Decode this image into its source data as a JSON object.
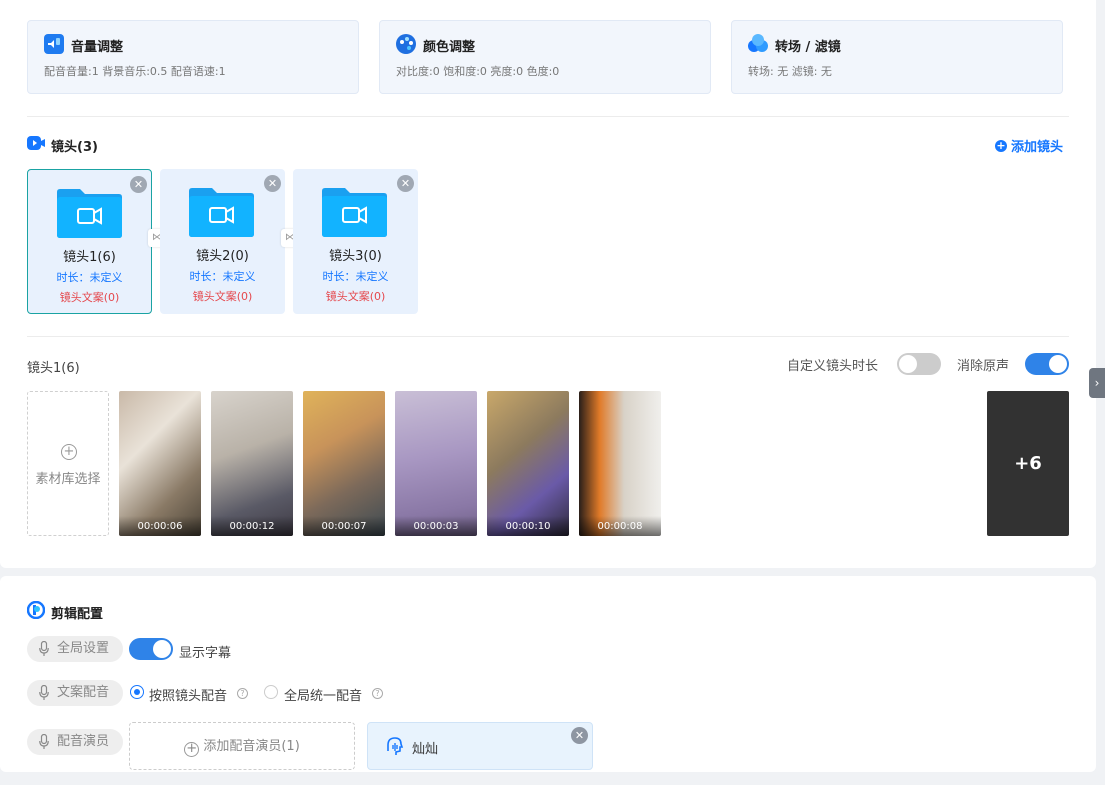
{
  "adjust_cards": [
    {
      "title": "音量调整",
      "sub": "配音音量:1 背景音乐:0.5 配音语速:1"
    },
    {
      "title": "颜色调整",
      "sub": "对比度:0 饱和度:0 亮度:0 色度:0"
    },
    {
      "title": "转场 / 滤镜",
      "sub": "转场: 无 滤镜: 无"
    }
  ],
  "shots_section": {
    "title": "镜头(3)",
    "add_label": "添加镜头"
  },
  "shots": [
    {
      "name": "镜头1(6)",
      "duration": "时长：未定义",
      "copy": "镜头文案(0)"
    },
    {
      "name": "镜头2(0)",
      "duration": "时长：未定义",
      "copy": "镜头文案(0)"
    },
    {
      "name": "镜头3(0)",
      "duration": "时长：未定义",
      "copy": "镜头文案(0)"
    }
  ],
  "current_shot": {
    "title": "镜头1(6)",
    "custom_duration_label": "自定义镜头时长",
    "mute_label": "消除原声",
    "material_select_label": "素材库选择",
    "more_label": "+6"
  },
  "thumbnails": [
    "00:00:06",
    "00:00:12",
    "00:00:07",
    "00:00:03",
    "00:00:10",
    "00:00:08"
  ],
  "edit_config": {
    "title": "剪辑配置",
    "global_tag": "全局设置",
    "subtitle_label": "显示字幕",
    "copy_voice_tag": "文案配音",
    "option_per_shot": "按照镜头配音",
    "option_global": "全局统一配音",
    "actor_tag": "配音演员",
    "add_actor": "添加配音演员(1)",
    "actor_name": "灿灿"
  },
  "colors": {
    "accent": "#1677ff",
    "danger": "#e5484d",
    "switch_on": "#2f83e8"
  }
}
